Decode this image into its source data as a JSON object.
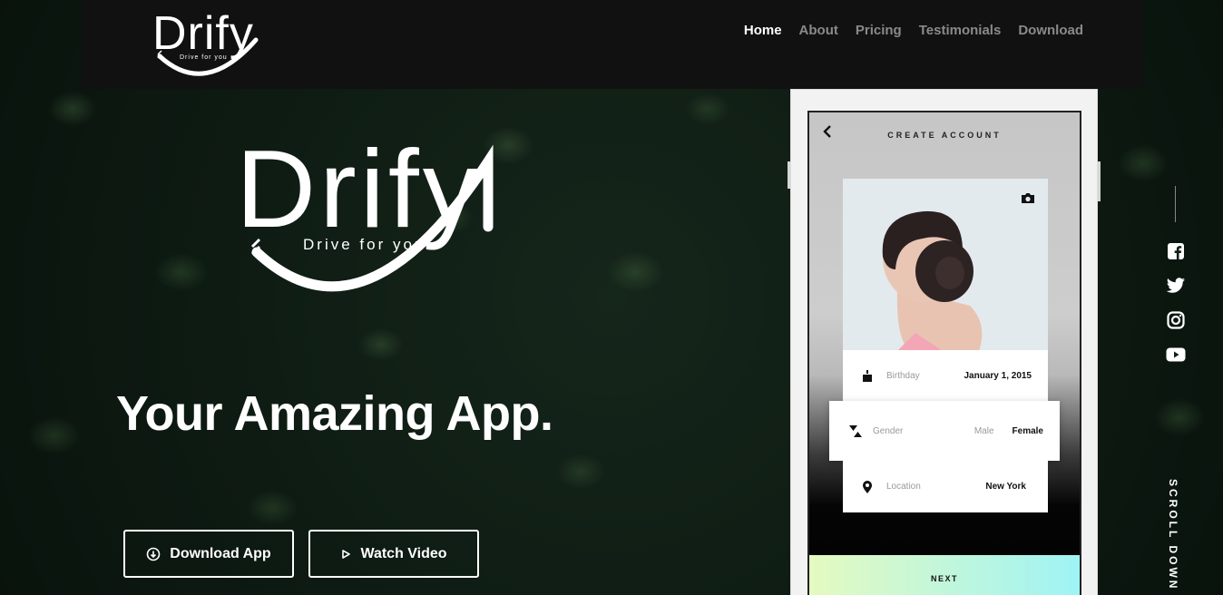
{
  "brand": {
    "name": "Drify",
    "tagline": "Drive for you"
  },
  "nav": {
    "items": [
      {
        "label": "Home",
        "active": true
      },
      {
        "label": "About",
        "active": false
      },
      {
        "label": "Pricing",
        "active": false
      },
      {
        "label": "Testimonials",
        "active": false
      },
      {
        "label": "Download",
        "active": false
      }
    ]
  },
  "hero": {
    "headline": "Your Amazing App.",
    "download_label": "Download App",
    "video_label": "Watch Video"
  },
  "phone": {
    "title": "CREATE ACCOUNT",
    "birthday": {
      "label": "Birthday",
      "value": "January 1, 2015"
    },
    "gender": {
      "label": "Gender",
      "option_1": "Male",
      "option_2": "Female",
      "selected": "Female"
    },
    "location": {
      "label": "Location",
      "value": "New York"
    },
    "next_label": "NEXT"
  },
  "social": {
    "icons": [
      "facebook-icon",
      "twitter-icon",
      "instagram-icon",
      "youtube-icon"
    ]
  },
  "scroll_label": "SCROLL DOWN",
  "colors": {
    "accent_gradient_start": "#e4fac0",
    "accent_gradient_end": "#9ff3f5",
    "nav_active": "#ffffff",
    "nav_inactive": "#8a8a8a"
  }
}
